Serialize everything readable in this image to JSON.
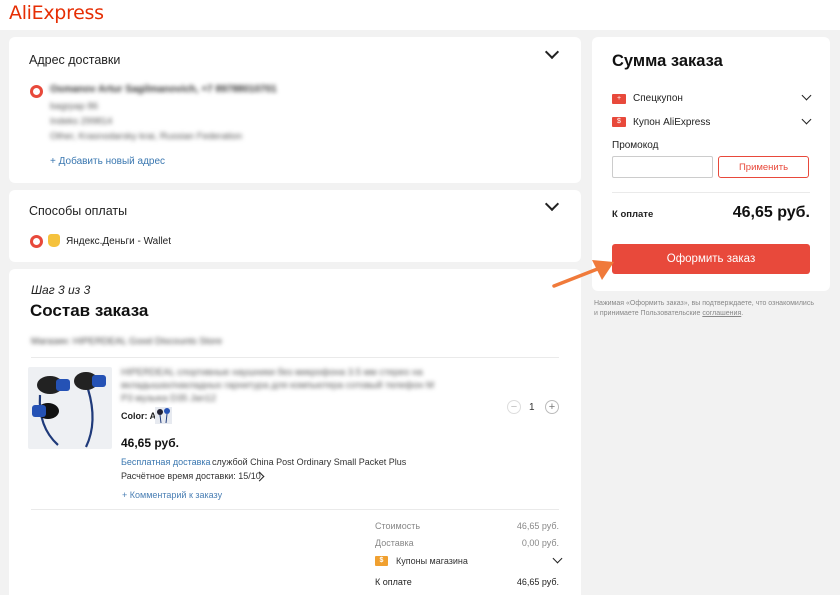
{
  "header": {
    "logo": "AliExpress"
  },
  "delivery": {
    "title": "Адрес доставки",
    "name": "Osmanov Artur Sagilmanovich, +7 89788010701",
    "line1": "bagrpap 86",
    "line2": "Indeks 299814",
    "line3": "Other, Krasnodarsky krai, Russian Federation",
    "add_address": "+ Добавить новый адрес"
  },
  "payment": {
    "title": "Способы оплаты",
    "method": "Яндекс.Деньги - Wallet"
  },
  "order": {
    "step": "Шаг 3 из 3",
    "title": "Состав заказа",
    "store": "Магазин: HIPERDEAL Good Discounts Store",
    "product_name_1": "HIPERDEAL спортивные наушники без микрофона 3.5 мм стерео на",
    "product_name_2": "вкладышах/накладных гарнитура для компьютера сотовый телефон M",
    "product_name_3": "P3 музыка D35 Jan12",
    "color_label": "Color: A",
    "price": "46,65 руб.",
    "quantity": "1",
    "minus": "−",
    "plus": "+",
    "free_shipping": "Бесплатная доставка",
    "shipping_service": "службой China Post Ordinary Small Packet Plus",
    "delivery_time": "Расчётное время доставки: 15/10",
    "comment": "+ Комментарий к заказу",
    "cost_label": "Стоимость",
    "cost_value": "46,65 руб.",
    "delivery_label": "Доставка",
    "delivery_value": "0,00 руб.",
    "store_coupons": "Купоны магазина",
    "total_label": "К оплате",
    "total_value": "46,65 руб."
  },
  "summary": {
    "title": "Сумма заказа",
    "special_coupon": "Спецкупон",
    "ali_coupon": "Купон AliExpress",
    "promo_label": "Промокод",
    "promo_placeholder": "",
    "apply": "Применить",
    "total_label": "К оплате",
    "total_value": "46,65 руб.",
    "order_button": "Оформить заказ",
    "disclaimer_1": "Нажимая «Оформить заказ», вы подтверждаете, что ознакомились",
    "disclaimer_2": "и принимаете Пользовательские",
    "disclaimer_link": "соглашения",
    "disclaimer_end": "."
  },
  "colors": {
    "accent": "#e8493b",
    "link": "#3a77b0",
    "background": "#f2f2f2"
  }
}
